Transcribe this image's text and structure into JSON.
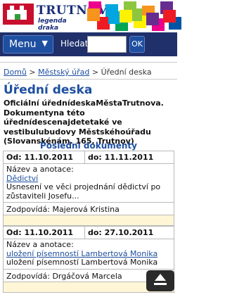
{
  "header": {
    "logo_name": "TRUTNOV",
    "logo_sub": "legenda draka",
    "tile_colors": [
      "#ec008c",
      "#00a6e0",
      "#8dc63f",
      "#f7941d",
      "#662d91",
      "#ed1c24",
      "#00a651",
      "#fff200",
      "#ec008c",
      "#0054a6",
      "#f7941d",
      "#8dc63f",
      "#00a6e0",
      "#ed1c24",
      "#662d91",
      "#fff200"
    ]
  },
  "nav": {
    "menu_label": "Menu",
    "search_label": "Hledat",
    "search_value": "",
    "ok_label": "OK"
  },
  "breadcrumb": {
    "home": "Domů",
    "sep1": ">",
    "office": "Městský úřad",
    "sep2": ">",
    "current": "Úřední deska"
  },
  "page": {
    "title": "Úřední deska",
    "intro": "Oficiální úřednídeskaMěstaTrutnova. Dokumentyna této úřednídescenajdetetaké ve vestibulubudovy Městskéhoúřadu (Slovanskénám. 165, Trutnov)"
  },
  "docs": {
    "title": "Poslední dokumenty",
    "items": [
      {
        "od": "Od: 11.10.2011",
        "do": "do: 11.11.2011",
        "nazev_label": "Název a anotace:",
        "link": "Dědictví",
        "annotation": "Usnesení  ve věci projednání dědictví po zůstaviteli Josefu...",
        "zodpovida": "Zodpovídá: Majerová Kristina"
      },
      {
        "od": "Od: 11.10.2011",
        "do": "do: 27.10.2011",
        "nazev_label": "Název a anotace:",
        "link": "uložení písemností  Lambertová Monika",
        "annotation": "uložení písemností  Lambertová Monika",
        "zodpovida": "Zodpovídá: Drgáčová Marcela"
      }
    ]
  }
}
